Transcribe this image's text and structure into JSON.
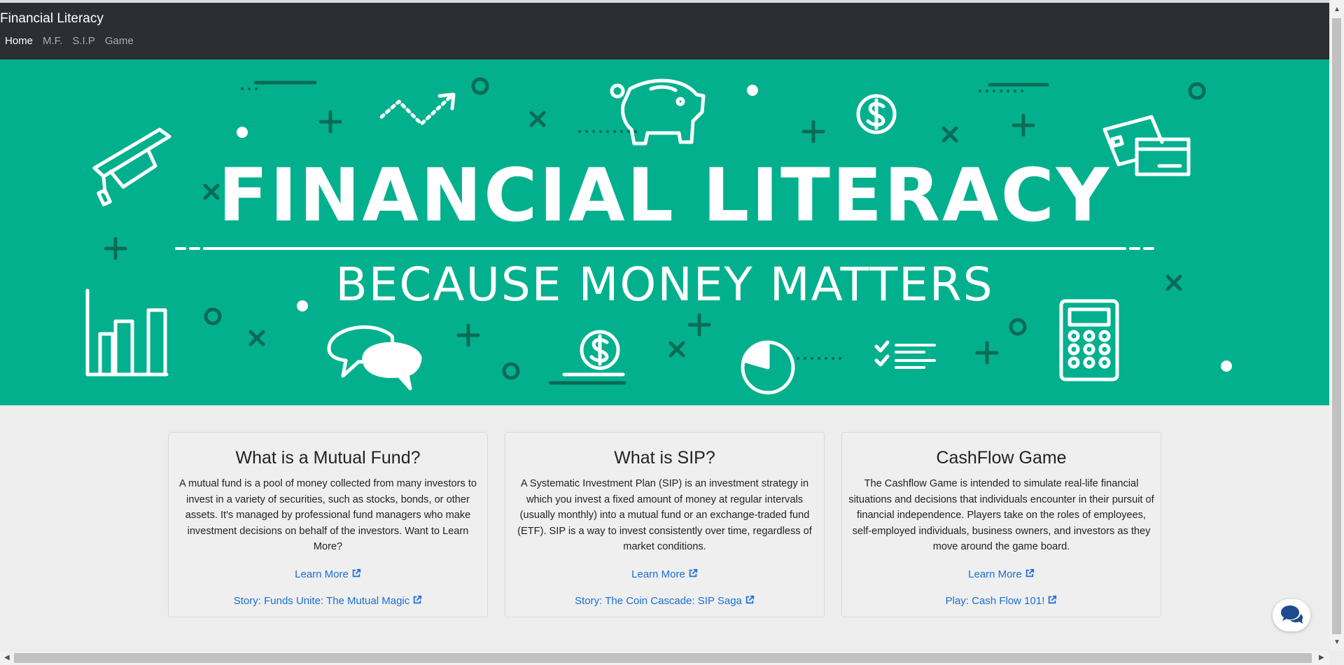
{
  "navbar": {
    "brand": "Financial Literacy",
    "links": [
      "Home",
      "M.F.",
      "S.I.P",
      "Game"
    ],
    "active": "Home"
  },
  "hero": {
    "title": "FINANCIAL LITERACY",
    "subtitle": "BECAUSE MONEY MATTERS",
    "background_color": "#03b08e",
    "icons": [
      "graduation-cap-icon",
      "piggy-bank-icon",
      "dollar-coin-icon",
      "credit-card-icon",
      "bar-chart-icon",
      "chat-bubbles-icon",
      "pie-chart-icon",
      "checklist-icon",
      "calculator-icon",
      "trend-arrow-icon"
    ]
  },
  "cards": [
    {
      "title": "What is a Mutual Fund?",
      "text": "A mutual fund is a pool of money collected from many investors to invest in a variety of securities, such as stocks, bonds, or other assets. It's managed by professional fund managers who make investment decisions on behalf of the investors. Want to Learn More?",
      "link1": "Learn More",
      "link2": "Story: Funds Unite: The Mutual Magic"
    },
    {
      "title": "What is SIP?",
      "text": "A Systematic Investment Plan (SIP) is an investment strategy in which you invest a fixed amount of money at regular intervals (usually monthly) into a mutual fund or an exchange-traded fund (ETF). SIP is a way to invest consistently over time, regardless of market conditions.",
      "link1": "Learn More",
      "link2": "Story: The Coin Cascade: SIP Saga"
    },
    {
      "title": "CashFlow Game",
      "text": "The Cashflow Game is intended to simulate real-life financial situations and decisions that individuals encounter in their pursuit of financial independence. Players take on the roles of employees, self-employed individuals, business owners, and investors as they move around the game board.",
      "link1": "Learn More",
      "link2": "Play: Cash Flow 101!"
    }
  ],
  "colors": {
    "navbar": "#2b2f33",
    "link": "#1a6fd6",
    "page_background": "#ededed"
  }
}
